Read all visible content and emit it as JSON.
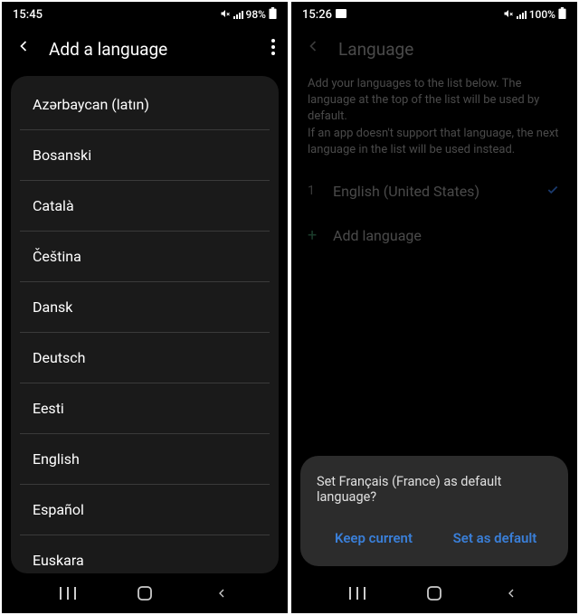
{
  "left": {
    "status": {
      "time": "15:45",
      "battery": "98%"
    },
    "header": {
      "title": "Add a language"
    },
    "languages": [
      "Azərbaycan (latın)",
      "Bosanski",
      "Català",
      "Čeština",
      "Dansk",
      "Deutsch",
      "Eesti",
      "English",
      "Español",
      "Euskara"
    ]
  },
  "right": {
    "status": {
      "time": "15:26",
      "battery": "100%"
    },
    "header": {
      "title": "Language"
    },
    "description_line1": "Add your languages to the list below. The language at the top of the list will be used by default.",
    "description_line2": "If an app doesn't support that language, the next language in the list will be used instead.",
    "list": {
      "index": "1",
      "current": "English (United States)",
      "add": "Add language"
    },
    "dialog": {
      "text": "Set Français (France) as default language?",
      "keep": "Keep current",
      "set": "Set as default"
    }
  }
}
